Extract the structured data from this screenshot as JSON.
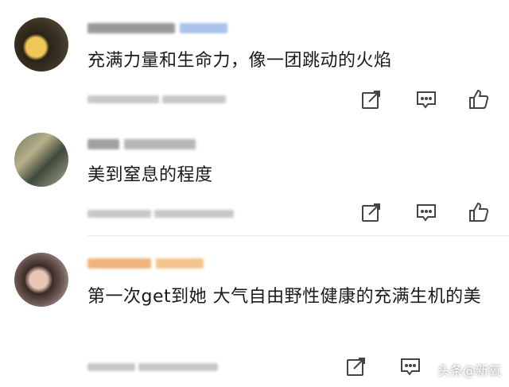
{
  "comments": [
    {
      "text": "充满力量和生命力，像一团跳动的火焰"
    },
    {
      "text": "美到窒息的程度"
    },
    {
      "text": "第一次get到她 大气自由野性健康的充满生机的美"
    }
  ],
  "icons": {
    "share": "share-icon",
    "reply": "reply-icon",
    "like": "thumbs-up-icon"
  },
  "watermark": {
    "label": "头条@新氧"
  }
}
